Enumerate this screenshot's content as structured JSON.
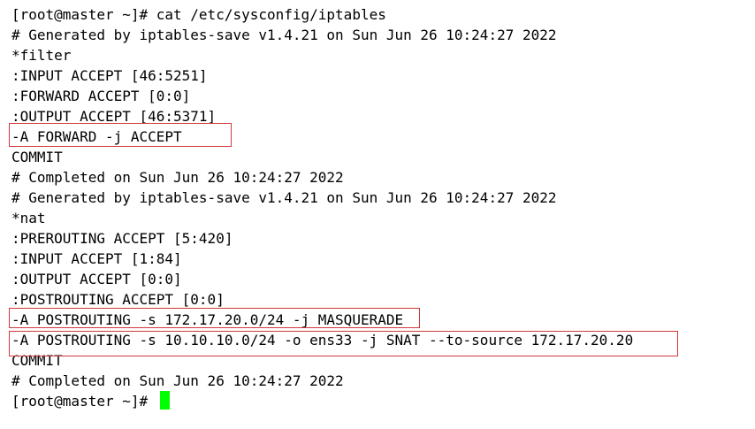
{
  "terminal": {
    "lines": [
      "[root@master ~]# cat /etc/sysconfig/iptables",
      "# Generated by iptables-save v1.4.21 on Sun Jun 26 10:24:27 2022",
      "*filter",
      ":INPUT ACCEPT [46:5251]",
      ":FORWARD ACCEPT [0:0]",
      ":OUTPUT ACCEPT [46:5371]",
      "-A FORWARD -j ACCEPT",
      "COMMIT",
      "# Completed on Sun Jun 26 10:24:27 2022",
      "# Generated by iptables-save v1.4.21 on Sun Jun 26 10:24:27 2022",
      "*nat",
      ":PREROUTING ACCEPT [5:420]",
      ":INPUT ACCEPT [1:84]",
      ":OUTPUT ACCEPT [0:0]",
      ":POSTROUTING ACCEPT [0:0]",
      "-A POSTROUTING -s 172.17.20.0/24 -j MASQUERADE",
      "-A POSTROUTING -s 10.10.10.0/24 -o ens33 -j SNAT --to-source 172.17.20.20",
      "COMMIT",
      "# Completed on Sun Jun 26 10:24:27 2022",
      "[root@master ~]# "
    ],
    "highlighted_lines": [
      6,
      15,
      16
    ],
    "colors": {
      "background": "#ffffff",
      "text": "#000000",
      "highlight_border": "#d03a3a",
      "cursor": "#00ff00"
    }
  }
}
